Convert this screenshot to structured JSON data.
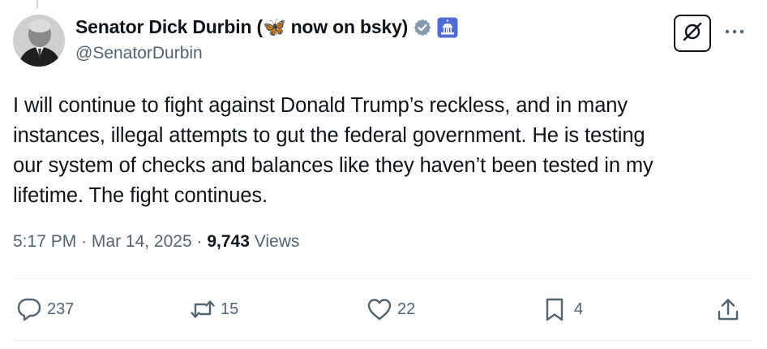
{
  "tweet": {
    "display_name": "Senator Dick Durbin (🦋 now on bsky)",
    "handle": "@SenatorDurbin",
    "text": "I will continue to fight against Donald Trump’s reckless, and in many\ninstances, illegal attempts to gut the federal government. He is testing\nour system of checks and balances like they haven’t been tested in my\nlifetime. The fight continues.",
    "time": "5:17 PM",
    "separator": "·",
    "date": "Mar 14, 2025",
    "views_count": "9,743",
    "views_label": "Views"
  },
  "actions": {
    "replies": "237",
    "reposts": "15",
    "likes": "22",
    "bookmarks": "4"
  },
  "icons": {
    "verified": "verified-badge-icon",
    "affiliation": "capitol-affiliation-icon",
    "grok": "grok-icon",
    "more": "more-dots-icon",
    "reply": "reply-icon",
    "repost": "repost-icon",
    "like": "heart-icon",
    "bookmark": "bookmark-icon",
    "share": "share-icon"
  },
  "colors": {
    "text": "#0f1419",
    "secondary": "#536471",
    "verified_gray": "#829aab",
    "affiliation_blue": "#4f6bd8"
  }
}
